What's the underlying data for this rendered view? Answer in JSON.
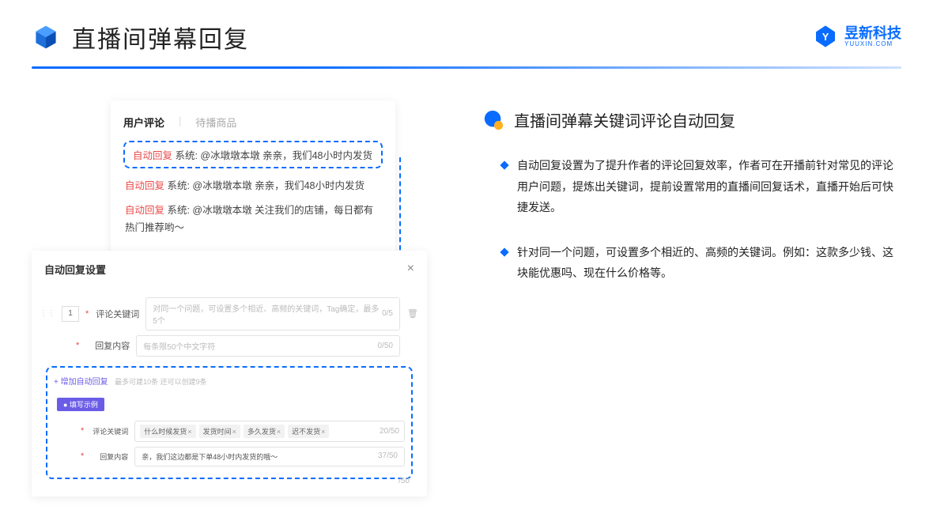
{
  "header": {
    "title": "直播间弹幕回复"
  },
  "brand": {
    "name": "昱新科技",
    "domain": "YUUXIN.COM"
  },
  "comments_card": {
    "tab_active": "用户评论",
    "tab_inactive": "待播商品",
    "highlighted": {
      "tag": "自动回复",
      "text": " 系统: @冰墩墩本墩 亲亲，我们48小时内发货"
    },
    "row1": {
      "tag": "自动回复",
      "text": " 系统: @冰墩墩本墩 亲亲，我们48小时内发货"
    },
    "row2": {
      "tag": "自动回复",
      "text": " 系统: @冰墩墩本墩 关注我们的店铺，每日都有热门推荐哟～"
    }
  },
  "settings_card": {
    "title": "自动回复设置",
    "num": "1",
    "keyword_label": "评论关键词",
    "keyword_placeholder": "对同一个问题，可设置多个相近、高频的关键词，Tag确定，最多5个",
    "keyword_count": "0/5",
    "content_label": "回复内容",
    "content_placeholder": "每条限50个中文字符",
    "content_count": "0/50",
    "add_link": "+ 增加自动回复",
    "add_hint": "最多可建10条 还可以创建9条",
    "example_badge": "● 填写示例",
    "ex_keyword_label": "评论关键词",
    "ex_tags": [
      "什么时候发货",
      "发货时间",
      "多久发货",
      "迟不发货"
    ],
    "ex_keyword_count": "20/50",
    "ex_content_label": "回复内容",
    "ex_content_value": "亲，我们这边都是下单48小时内发货的哦～",
    "ex_content_count": "37/50",
    "bottom_count": "/50"
  },
  "right": {
    "section_title": "直播间弹幕关键词评论自动回复",
    "bullet1": "自动回复设置为了提升作者的评论回复效率，作者可在开播前针对常见的评论用户问题，提炼出关键词，提前设置常用的直播间回复话术，直播开始后可快捷发送。",
    "bullet2": "针对同一个问题，可设置多个相近的、高频的关键词。例如：这款多少钱、这块能优惠吗、现在什么价格等。"
  }
}
